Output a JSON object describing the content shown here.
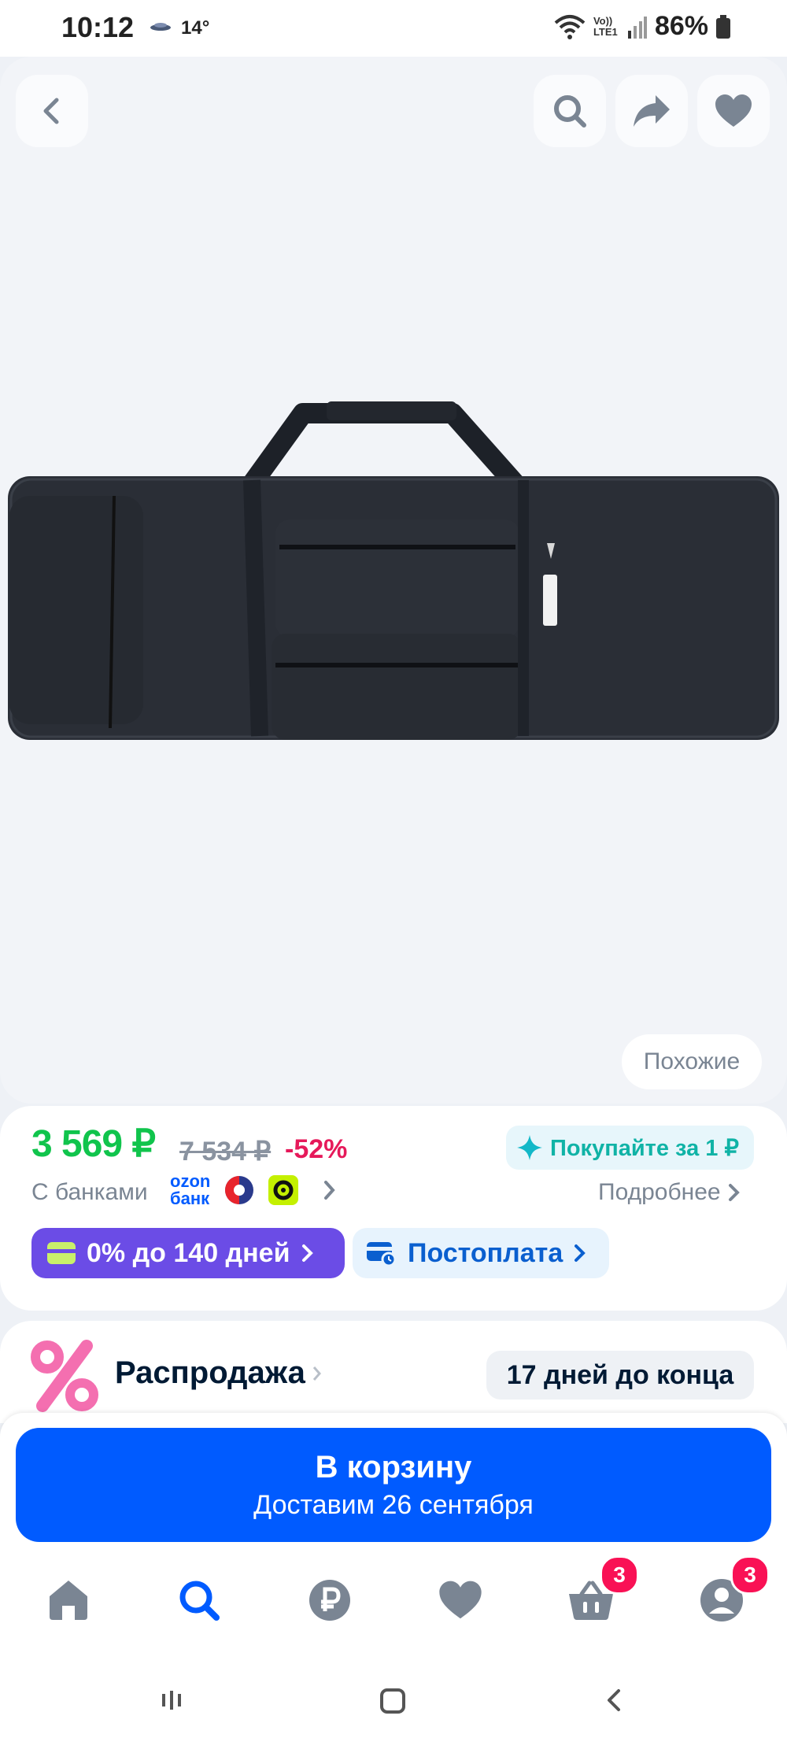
{
  "status_bar": {
    "time": "10:12",
    "temperature": "14°",
    "battery": "86%",
    "network": "Vo)) LTE1"
  },
  "hero": {
    "similar_label": "Похожие"
  },
  "price": {
    "current": "3 569 ₽",
    "old": "7 534 ₽",
    "discount": "-52%",
    "buy_for_1_label": "Покупайте за 1 ₽",
    "banks_label": "С банками",
    "ozon_bank_line1": "ozon",
    "ozon_bank_line2": "банк",
    "more_label": "Подробнее",
    "installment_label": "0% до 140 дней",
    "postpay_label": "Постоплата"
  },
  "sale": {
    "title": "Распродажа",
    "days_left": "17 дней до конца"
  },
  "cart": {
    "button_label": "В корзину",
    "delivery_label": "Доставим 26 сентября"
  },
  "nav": {
    "cart_badge": "3",
    "profile_badge": "3"
  },
  "colors": {
    "accent": "#005bff",
    "price_green": "#10c44c",
    "discount_pink": "#e6195a",
    "installment_purple": "#6b4ce6",
    "badge_pink": "#f91155"
  }
}
